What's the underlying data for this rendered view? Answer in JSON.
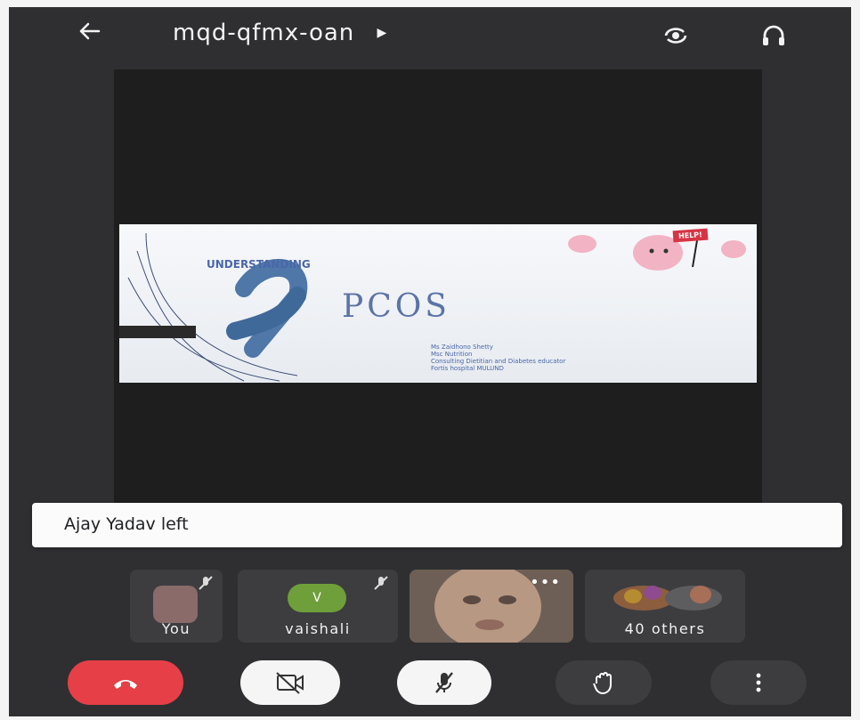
{
  "top_bar": {
    "meeting_code": "mqd-qfmx-oan",
    "back_icon": "arrow-left-icon",
    "switch_camera_icon": "camera-switch-icon",
    "audio_icon": "headphones-icon",
    "title_arrow_icon": "play-arrow-icon"
  },
  "presentation": {
    "heading": "UNDERSTANDING",
    "title": "PCOS",
    "sign_text": "HELP!",
    "presenter_lines": [
      "Ms Zaidhono Shetty",
      "Msc Nutrition",
      "Consulting Dietitian and Diabetes educator",
      "Fortis hospital   MULUND"
    ]
  },
  "notification": {
    "text": "Ajay Yadav left"
  },
  "participants": [
    {
      "label": "You",
      "muted": true
    },
    {
      "label": "vaishali",
      "initial": "V",
      "avatar_color": "#6f9f3a",
      "muted": true
    },
    {
      "label": "",
      "kind": "video-tile",
      "menu_icon": "more-horizontal-icon"
    },
    {
      "label": "40 others"
    }
  ],
  "controls": {
    "end_call_icon": "end-call-icon",
    "video_icon": "camera-off-icon",
    "mic_icon": "mic-off-icon",
    "raise_hand_icon": "raise-hand-icon",
    "more_icon": "more-vertical-icon"
  },
  "colors": {
    "background": "#2f2f31",
    "stage": "#1e1e1f",
    "tile": "#3d3d40",
    "end_call": "#e63f48",
    "slide_text": "#4a67a8"
  }
}
